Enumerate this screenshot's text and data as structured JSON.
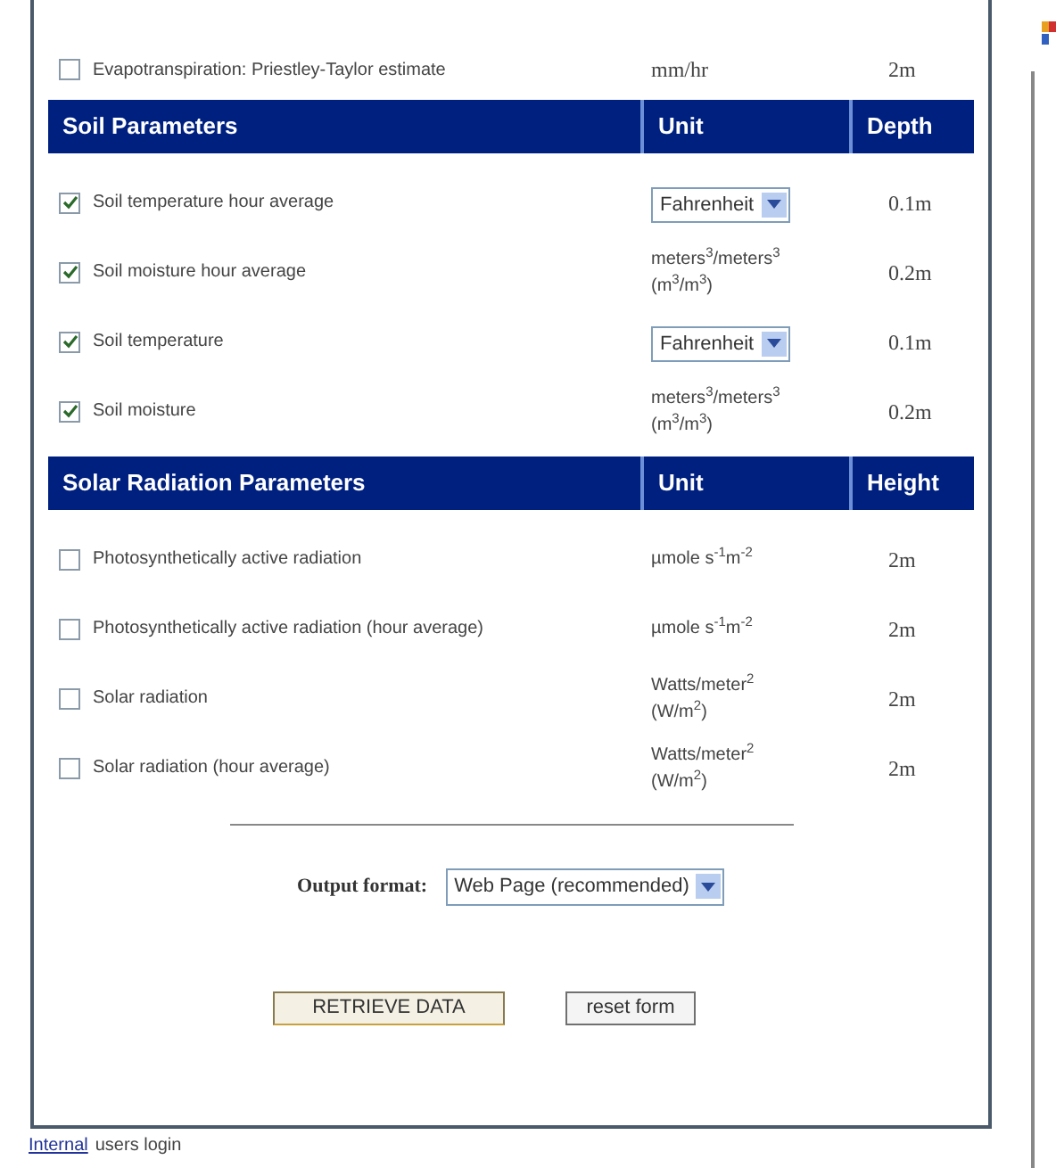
{
  "sections": [
    {
      "rows": [
        {
          "label": "Evapotranspiration: Priestley-Taylor estimate",
          "checked": false,
          "unit": {
            "kind": "serif",
            "lines": [
              "mm/hr"
            ]
          },
          "value": "2m"
        }
      ]
    },
    {
      "header": {
        "title": "Soil Parameters",
        "unit": "Unit",
        "value": "Depth"
      },
      "rows": [
        {
          "label": "Soil temperature hour average",
          "checked": true,
          "unit": {
            "kind": "select",
            "lines": [
              "Fahrenheit"
            ]
          },
          "value": "0.1m"
        },
        {
          "label": "Soil moisture hour average",
          "checked": true,
          "unit": {
            "kind": "text",
            "lines": [
              "meters$^{3}$/meters$^{3}$",
              "(m$^{3}$/m$^{3}$)"
            ]
          },
          "value": "0.2m"
        },
        {
          "label": "Soil temperature",
          "checked": true,
          "unit": {
            "kind": "select",
            "lines": [
              "Fahrenheit"
            ]
          },
          "value": "0.1m"
        },
        {
          "label": "Soil moisture",
          "checked": true,
          "unit": {
            "kind": "text",
            "lines": [
              "meters$^{3}$/meters$^{3}$",
              "(m$^{3}$/m$^{3}$)"
            ]
          },
          "value": "0.2m"
        }
      ]
    },
    {
      "header": {
        "title": "Solar Radiation Parameters",
        "unit": "Unit",
        "value": "Height"
      },
      "rows": [
        {
          "label": "Photosynthetically active radiation",
          "checked": false,
          "unit": {
            "kind": "text",
            "lines": [
              "µmole s$^{-1}$m$^{-2}$"
            ]
          },
          "value": "2m"
        },
        {
          "label": "Photosynthetically active radiation (hour average)",
          "checked": false,
          "unit": {
            "kind": "text",
            "lines": [
              "µmole s$^{-1}$m$^{-2}$"
            ]
          },
          "value": "2m"
        },
        {
          "label": "Solar radiation",
          "checked": false,
          "unit": {
            "kind": "text",
            "lines": [
              "Watts/meter$^{2}$",
              "(W/m$^{2}$)"
            ]
          },
          "value": "2m"
        },
        {
          "label": "Solar radiation (hour average)",
          "checked": false,
          "unit": {
            "kind": "text",
            "lines": [
              "Watts/meter$^{2}$",
              "(W/m$^{2}$)"
            ]
          },
          "value": "2m"
        }
      ]
    }
  ],
  "output_format": {
    "label": "Output format:",
    "value": "Web Page (recommended)"
  },
  "buttons": [
    {
      "label": "RETRIEVE DATA",
      "kind": "primary"
    },
    {
      "label": "reset form",
      "kind": "secondary"
    }
  ],
  "footer": {
    "link": "Internal",
    "text": "users login"
  }
}
